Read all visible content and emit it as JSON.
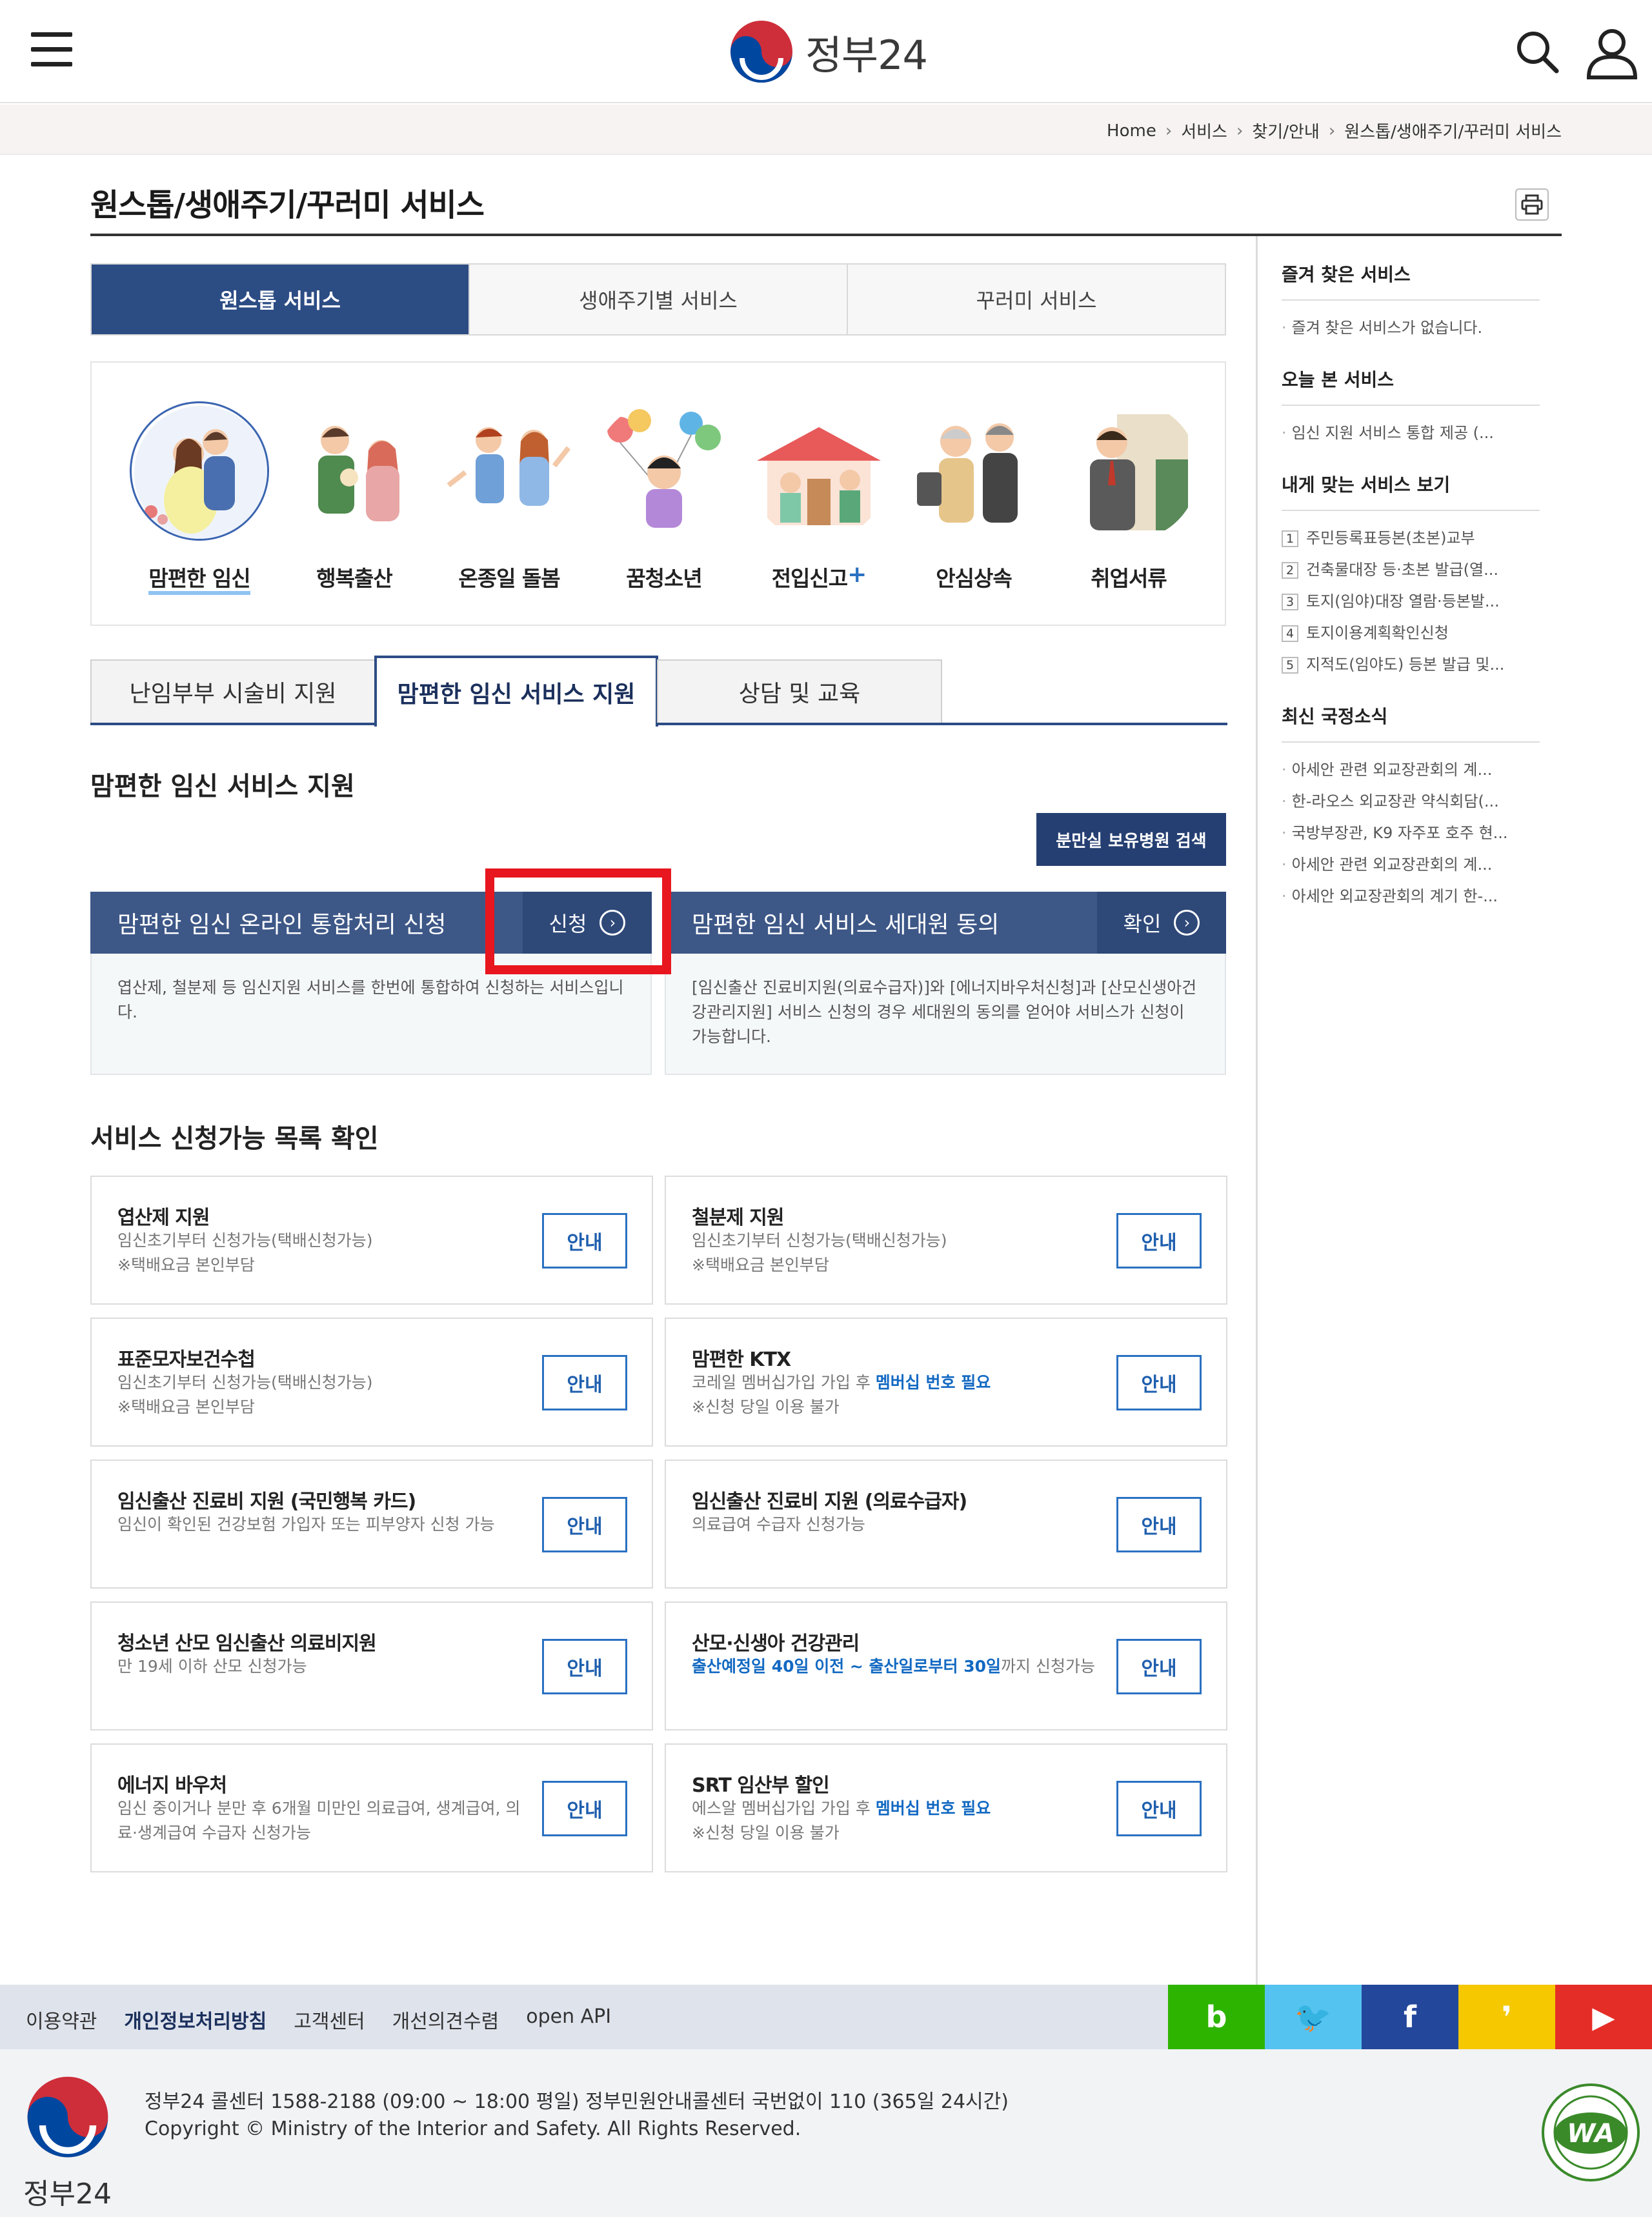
{
  "header": {
    "logo_text": "정부24",
    "menu_icon": "hamburger-icon",
    "search_icon": "search-icon",
    "user_icon": "user-icon"
  },
  "breadcrumb": [
    "Home",
    "서비스",
    "찾기/안내",
    "원스톱/생애주기/꾸러미 서비스"
  ],
  "page_title": "원스톱/생애주기/꾸러미 서비스",
  "main_tabs": [
    {
      "label": "원스톱 서비스",
      "active": true
    },
    {
      "label": "생애주기별 서비스",
      "active": false
    },
    {
      "label": "꾸러미 서비스",
      "active": false
    }
  ],
  "services_icons": [
    {
      "label": "맘편한 임신",
      "active": true
    },
    {
      "label": "행복출산",
      "active": false
    },
    {
      "label": "온종일 돌봄",
      "active": false
    },
    {
      "label": "꿈청소년",
      "active": false
    },
    {
      "label": "전입신고",
      "plus": "+",
      "active": false
    },
    {
      "label": "안심상속",
      "active": false
    },
    {
      "label": "취업서류",
      "active": false
    }
  ],
  "sub_tabs": [
    {
      "label": "난임부부 시술비 지원",
      "active": false
    },
    {
      "label": "맘편한 임신 서비스 지원",
      "active": true
    },
    {
      "label": "상담 및 교육",
      "active": false
    }
  ],
  "section_title": "맘편한 임신 서비스 지원",
  "hospital_search_button": "분만실 보유병원 검색",
  "apply_boxes": [
    {
      "title": "맘편한 임신 온라인 통합처리 신청",
      "action": "신청",
      "desc": "엽산제, 철분제 등 임신지원 서비스를 한번에 통합하여 신청하는 서비스입니다."
    },
    {
      "title": "맘편한 임신 서비스 세대원 동의",
      "action": "확인",
      "desc": "[임신출산 진료비지원(의료수급자)]와 [에너지바우처신청]과 [산모신생아건강관리지원] 서비스 신청의 경우 세대원의 동의를 얻어야 서비스가 신청이 가능합니다."
    }
  ],
  "list_title": "서비스 신청가능 목록 확인",
  "service_list": [
    {
      "name": "엽산제 지원",
      "line1": "임신초기부터 신청가능(택배신청가능)",
      "line2": "※택배요금 본인부담",
      "button": "안내"
    },
    {
      "name": "철분제 지원",
      "line1": "임신초기부터 신청가능(택배신청가능)",
      "line2": "※택배요금 본인부담",
      "button": "안내"
    },
    {
      "name": "표준모자보건수첩",
      "line1": "임신초기부터 신청가능(택배신청가능)",
      "line2": "※택배요금 본인부담",
      "button": "안내"
    },
    {
      "name": "맘편한 KTX",
      "line1_pre": "코레일 멤버십가입 가입 후 ",
      "line1_hl": "멤버십 번호 필요",
      "line2": "※신청 당일 이용 불가",
      "button": "안내"
    },
    {
      "name": "임신출산 진료비 지원 (국민행복 카드)",
      "line1": "임신이 확인된 건강보험 가입자 또는 피부양자 신청 가능",
      "button": "안내"
    },
    {
      "name": "임신출산 진료비 지원 (의료수급자)",
      "line1": "의료급여 수급자 신청가능",
      "button": "안내"
    },
    {
      "name": "청소년 산모 임신출산 의료비지원",
      "line1": "만 19세 이하 산모 신청가능",
      "button": "안내"
    },
    {
      "name": "산모·신생아 건강관리",
      "line1_hl": "출산예정일 40일 이전 ~ 출산일로부터 30일",
      "line1_post": "까지 신청가능",
      "button": "안내"
    },
    {
      "name": "에너지 바우처",
      "line1": "임신 중이거나 분만 후 6개월 미만인 의료급여, 생계급여, 의",
      "line2": "료·생계급여 수급자 신청가능",
      "button": "안내"
    },
    {
      "name": "SRT 임산부 할인",
      "line1_pre": "에스알 멤버십가입 가입 후 ",
      "line1_hl": "멤버십 번호 필요",
      "line2": "※신청 당일 이용 불가",
      "button": "안내"
    }
  ],
  "sidebar": {
    "favorites": {
      "title": "즐겨 찾은 서비스",
      "items": [
        "즐겨 찾은 서비스가 없습니다."
      ]
    },
    "today": {
      "title": "오늘 본 서비스",
      "items": [
        "임신 지원 서비스 통합 제공 (..."
      ]
    },
    "recommended": {
      "title": "내게 맞는 서비스 보기",
      "items": [
        "주민등록표등본(초본)교부",
        "건축물대장 등·초본 발급(열...",
        "토지(임야)대장 열람·등본발...",
        "토지이용계획확인신청",
        "지적도(임야도) 등본 발급 및..."
      ]
    },
    "news": {
      "title": "최신 국정소식",
      "items": [
        "아세안 관련 외교장관회의 계...",
        "한-라오스 외교장관 약식회담(...",
        "국방부장관, K9 자주포 호주 현...",
        "아세안 관련 외교장관회의 계...",
        "아세안 외교장관회의 계기 한-..."
      ]
    }
  },
  "footer": {
    "links": [
      "이용약관",
      "개인정보처리방침",
      "고객센터",
      "개선의견수렴",
      "open API"
    ],
    "social": [
      {
        "icon": "blog-icon",
        "glyph": "b",
        "color": "#2db400"
      },
      {
        "icon": "twitter-icon",
        "glyph": "🐦",
        "color": "#55c3f0"
      },
      {
        "icon": "facebook-icon",
        "glyph": "f",
        "color": "#23479b"
      },
      {
        "icon": "kakaostory-icon",
        "glyph": "❜",
        "color": "#f5c800"
      },
      {
        "icon": "youtube-icon",
        "glyph": "▶",
        "color": "#e52d27"
      }
    ],
    "line1": "정부24 콜센터 1588-2188 (09:00 ~ 18:00 평일) 정부민원안내콜센터 국번없이 110 (365일 24시간)",
    "line2": "Copyright © Ministry of the Interior and Safety. All Rights Reserved.",
    "logo_text": "정부24",
    "wa_mark": "WA"
  }
}
